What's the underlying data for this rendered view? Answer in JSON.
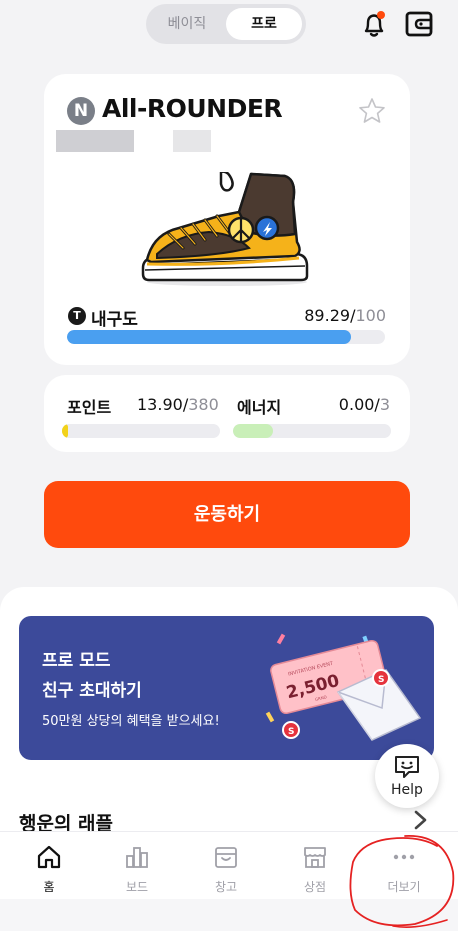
{
  "mode_toggle": {
    "basic": "베이직",
    "pro": "프로"
  },
  "header_icons": {
    "bell": "bell-icon",
    "wallet": "wallet-icon",
    "notification_dot_color": "#ff4a0d"
  },
  "shoe": {
    "grade_letter": "N",
    "name": "All-ROUNDER",
    "durability_label": "내구도",
    "durability_icon": "T",
    "durability_value": "89.29",
    "durability_max": "100",
    "durability_fraction": 0.8929
  },
  "stats": {
    "points_label": "포인트",
    "points_value": "13.90",
    "points_max": "380",
    "points_fraction": 0.0366,
    "energy_label": "에너지",
    "energy_value": "0.00",
    "energy_max": "3",
    "energy_fraction": 0.0
  },
  "workout_button": "운동하기",
  "banner": {
    "line1": "프로 모드",
    "line2": "친구 초대하기",
    "sub": "50만원 상당의 혜택을 받으세요!",
    "ticket_title": "INVITATION EVENT",
    "ticket_amount": "2,500",
    "ticket_unit": "GRND"
  },
  "raffle_title": "행운의 래플",
  "help": {
    "label": "Help"
  },
  "tabs": [
    {
      "label": "홈",
      "icon": "home-icon"
    },
    {
      "label": "보드",
      "icon": "chart-icon"
    },
    {
      "label": "창고",
      "icon": "storage-box-icon"
    },
    {
      "label": "상점",
      "icon": "store-icon"
    },
    {
      "label": "더보기",
      "icon": "more-icon"
    }
  ],
  "colors": {
    "accent": "#ff4a0d",
    "durability": "#4a9ff0",
    "points": "#f2d21a",
    "energy": "#c9efb8",
    "banner": "#3c4a9a"
  }
}
